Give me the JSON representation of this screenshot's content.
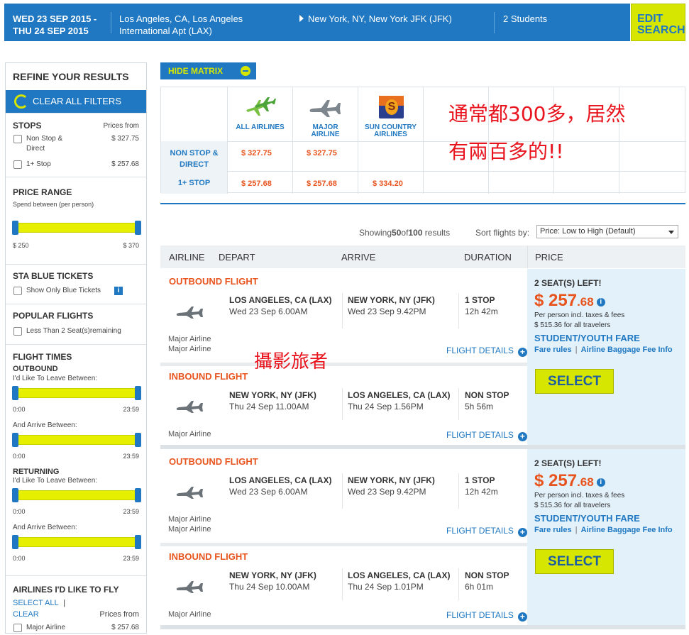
{
  "search": {
    "dates": [
      "WED 23 SEP 2015 -",
      "THU 24 SEP 2015"
    ],
    "origin": [
      "Los Angeles, CA, Los Angeles",
      "International Apt (LAX)"
    ],
    "destination": "New York, NY, New York JFK (JFK)",
    "travelers": "2 Students",
    "edit_label": [
      "EDIT",
      "SEARCH"
    ]
  },
  "sidebar": {
    "title": "REFINE YOUR RESULTS",
    "clear_all": "CLEAR ALL FILTERS",
    "stops": {
      "title": "STOPS",
      "prices_from": "Prices from",
      "options": [
        {
          "label": [
            "Non Stop &",
            "Direct"
          ],
          "price": "$ 327.75"
        },
        {
          "label": [
            "1+ Stop"
          ],
          "price": "$ 257.68"
        }
      ]
    },
    "price_range": {
      "title": "PRICE RANGE",
      "subtitle": "Spend between (per person)",
      "min": "$ 250",
      "max": "$ 370"
    },
    "blue_tickets": {
      "title": "STA BLUE TICKETS",
      "option": "Show Only Blue Tickets"
    },
    "popular": {
      "title": "POPULAR FLIGHTS",
      "option": "Less Than 2 Seat(s)remaining"
    },
    "flight_times": {
      "title": "FLIGHT TIMES",
      "outbound": "OUTBOUND",
      "returning": "RETURNING",
      "leave": "I'd Like To Leave Between:",
      "arrive": "And Arrive Between:",
      "start": "0:00",
      "end": "23:59"
    },
    "airlines": {
      "title": "AIRLINES I'D LIKE TO FLY",
      "select_all": "SELECT ALL",
      "sep": "|",
      "clear": "CLEAR",
      "prices_from": "Prices from",
      "option": "Major Airline",
      "price": "$ 257.68"
    }
  },
  "matrix": {
    "toggle": "HIDE MATRIX",
    "airlines": [
      [
        "ALL AIRLINES"
      ],
      [
        "MAJOR",
        "AIRLINE"
      ],
      [
        "SUN COUNTRY",
        "AIRLINES"
      ]
    ],
    "rows": [
      {
        "label": [
          "NON STOP &",
          "DIRECT"
        ],
        "prices": [
          "$ 327.75",
          "$ 327.75",
          ""
        ]
      },
      {
        "label": [
          "1+ STOP"
        ],
        "prices": [
          "$ 257.68",
          "$ 257.68",
          "$ 334.20"
        ]
      }
    ],
    "note_lines": [
      "通常都300多，居然",
      "有兩百多的!!"
    ]
  },
  "watermark": "攝影旅者",
  "results": {
    "showing_prefix": "Showing",
    "shown": "50",
    "of": "of",
    "total": "100",
    "suffix": "results",
    "sort_label": "Sort flights by:",
    "sort_value": "Price: Low to High (Default)",
    "columns": {
      "airline": "AIRLINE",
      "depart": "DEPART",
      "arrive": "ARRIVE",
      "duration": "DURATION",
      "price": "PRICE"
    }
  },
  "itineraries": [
    {
      "outbound": {
        "label": "OUTBOUND FLIGHT",
        "from": "LOS ANGELES, CA (LAX)",
        "dep": "Wed 23 Sep 6.00AM",
        "to": "NEW YORK, NY (JFK)",
        "arr": "Wed 23 Sep 9.42PM",
        "stops": "1 STOP",
        "dur": "12h 42m",
        "airline": [
          "Major Airline",
          "Major Airline"
        ],
        "details": "FLIGHT DETAILS"
      },
      "inbound": {
        "label": "INBOUND FLIGHT",
        "from": "NEW YORK, NY (JFK)",
        "dep": "Thu 24 Sep 11.00AM",
        "to": "LOS ANGELES, CA (LAX)",
        "arr": "Thu 24 Sep 1.56PM",
        "stops": "NON STOP",
        "dur": "5h 56m",
        "airline": [
          "Major Airline"
        ],
        "details": "FLIGHT DETAILS"
      },
      "seats": "2 SEAT(S) LEFT!",
      "price_main": "$ 257",
      "price_cents": ".68",
      "per_person": "Per person incl. taxes & fees",
      "total": "$ 515.36 for all travelers",
      "fare": "STUDENT/YOUTH FARE",
      "fare_rules": "Fare rules",
      "baggage": "Airline Baggage Fee Info",
      "select": "SELECT"
    },
    {
      "outbound": {
        "label": "OUTBOUND FLIGHT",
        "from": "LOS ANGELES, CA (LAX)",
        "dep": "Wed 23 Sep 6.00AM",
        "to": "NEW YORK, NY (JFK)",
        "arr": "Wed 23 Sep 9.42PM",
        "stops": "1 STOP",
        "dur": "12h 42m",
        "airline": [
          "Major Airline",
          "Major Airline"
        ],
        "details": "FLIGHT DETAILS"
      },
      "inbound": {
        "label": "INBOUND FLIGHT",
        "from": "NEW YORK, NY (JFK)",
        "dep": "Thu 24 Sep 10.00AM",
        "to": "LOS ANGELES, CA (LAX)",
        "arr": "Thu 24 Sep 1.01PM",
        "stops": "NON STOP",
        "dur": "6h 01m",
        "airline": [
          "Major Airline"
        ],
        "details": "FLIGHT DETAILS"
      },
      "seats": "2 SEAT(S) LEFT!",
      "price_main": "$ 257",
      "price_cents": ".68",
      "per_person": "Per person incl. taxes & fees",
      "total": "$ 515.36 for all travelers",
      "fare": "STUDENT/YOUTH FARE",
      "fare_rules": "Fare rules",
      "baggage": "Airline Baggage Fee Info",
      "select": "SELECT"
    }
  ]
}
